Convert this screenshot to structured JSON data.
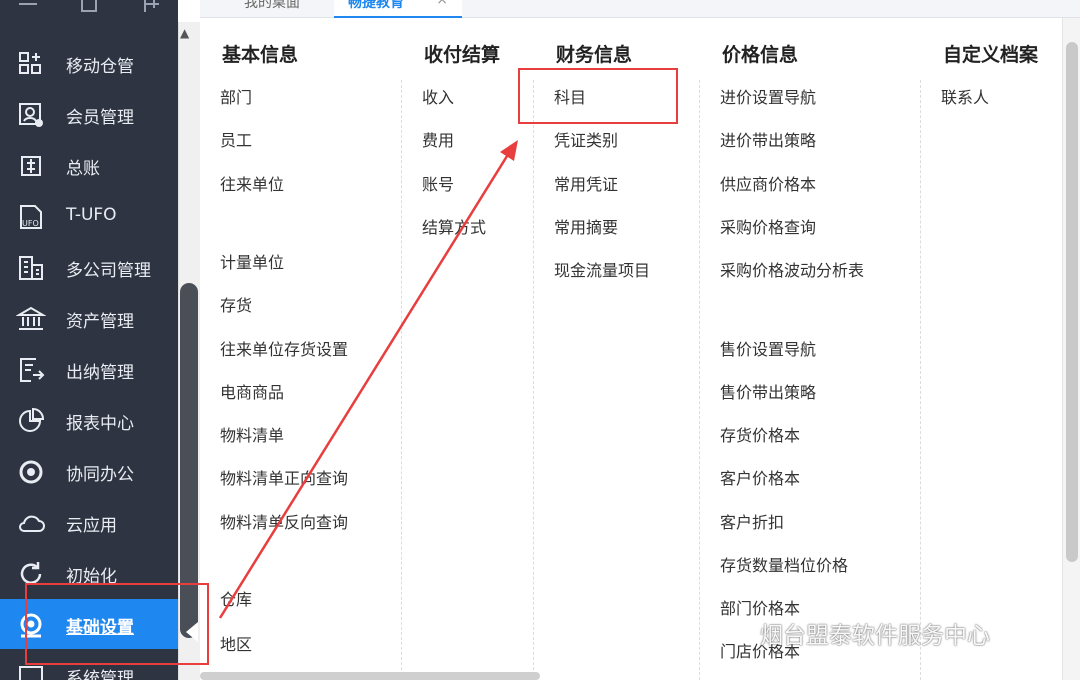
{
  "tabs": [
    {
      "label": "我的桌面"
    },
    {
      "label": "畅捷教育",
      "close": "×"
    }
  ],
  "sidebar": {
    "items": [
      {
        "label": "移动仓管",
        "icon": "mobile-warehouse-icon"
      },
      {
        "label": "会员管理",
        "icon": "member-icon"
      },
      {
        "label": "总账",
        "icon": "ledger-icon"
      },
      {
        "label": "T-UFO",
        "icon": "ufo-icon"
      },
      {
        "label": "多公司管理",
        "icon": "company-icon"
      },
      {
        "label": "资产管理",
        "icon": "bank-icon"
      },
      {
        "label": "出纳管理",
        "icon": "cashier-icon"
      },
      {
        "label": "报表中心",
        "icon": "pie-chart-icon"
      },
      {
        "label": "协同办公",
        "icon": "collab-icon"
      },
      {
        "label": "云应用",
        "icon": "cloud-icon"
      },
      {
        "label": "初始化",
        "icon": "refresh-icon"
      },
      {
        "label": "基础设置",
        "icon": "settings-icon",
        "active": true
      },
      {
        "label": "系统管理",
        "icon": "system-icon"
      }
    ]
  },
  "menu": {
    "columns": [
      {
        "title": "基本信息",
        "items": [
          "部门",
          "员工",
          "往来单位",
          "计量单位",
          "存货",
          "往来单位存货设置",
          "电商商品",
          "物料清单",
          "物料清单正向查询",
          "物料清单反向查询",
          "仓库",
          "地区"
        ]
      },
      {
        "title": "收付结算",
        "items": [
          "收入",
          "费用",
          "账号",
          "结算方式"
        ]
      },
      {
        "title": "财务信息",
        "items": [
          "科目",
          "凭证类别",
          "常用凭证",
          "常用摘要",
          "现金流量项目"
        ]
      },
      {
        "title": "价格信息",
        "items": [
          "进价设置导航",
          "进价带出策略",
          "供应商价格本",
          "采购价格查询",
          "采购价格波动分析表",
          "售价设置导航",
          "售价带出策略",
          "存货价格本",
          "客户价格本",
          "客户折扣",
          "存货数量档位价格",
          "部门价格本",
          "门店价格本"
        ]
      },
      {
        "title": "自定义档案",
        "items": [
          "联系人"
        ]
      }
    ]
  },
  "colors": {
    "sidebar": "#2e3441",
    "accent": "#1e87f0",
    "annotation": "#e83e3e"
  },
  "watermark": "烟台盟泰软件服务中心"
}
